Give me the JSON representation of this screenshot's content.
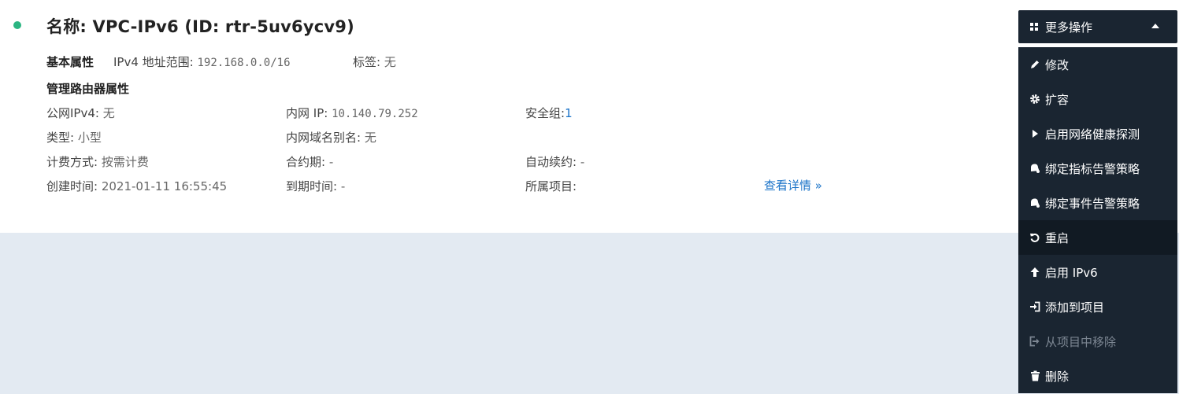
{
  "header": {
    "title": "名称: VPC-IPv6 (ID: rtr-5uv6ycv9)",
    "status_color": "#2bb582"
  },
  "basic": {
    "section_label": "基本属性",
    "ipv4_range_label": "IPv4 地址范围:",
    "ipv4_range_value": "192.168.0.0/16",
    "tags_label": "标签:",
    "tags_value": "无"
  },
  "mgmt": {
    "section_label": "管理路由器属性",
    "public_ipv4_label": "公网IPv4:",
    "public_ipv4_value": "无",
    "private_ip_label": "内网 IP:",
    "private_ip_value": "10.140.79.252",
    "security_group_label": "安全组:",
    "security_group_value": "1",
    "type_label": "类型:",
    "type_value": "小型",
    "private_domain_label": "内网域名别名:",
    "private_domain_value": "无",
    "billing_label": "计费方式:",
    "billing_value": "按需计费",
    "contract_label": "合约期:",
    "contract_value": "-",
    "auto_renew_label": "自动续约:",
    "auto_renew_value": "-",
    "created_label": "创建时间:",
    "created_value": "2021-01-11 16:55:45",
    "expire_label": "到期时间:",
    "expire_value": "-",
    "project_label": "所属项目:",
    "project_value": "",
    "details_link": "查看详情 »"
  },
  "actions": {
    "button_label": "更多操作",
    "items": [
      {
        "label": "修改",
        "icon": "pencil-icon"
      },
      {
        "label": "扩容",
        "icon": "gear-icon"
      },
      {
        "label": "启用网络健康探测",
        "icon": "play-icon"
      },
      {
        "label": "绑定指标告警策略",
        "icon": "bell-icon"
      },
      {
        "label": "绑定事件告警策略",
        "icon": "bell-icon"
      },
      {
        "label": "重启",
        "icon": "restart-icon"
      },
      {
        "label": "启用 IPv6",
        "icon": "arrow-up-icon"
      },
      {
        "label": "添加到项目",
        "icon": "sign-in-icon"
      },
      {
        "label": "从项目中移除",
        "icon": "sign-out-icon",
        "disabled": true
      },
      {
        "label": "删除",
        "icon": "trash-icon"
      }
    ],
    "colors": {
      "menu_bg": "#1a2531",
      "hover_bg": "#111a23",
      "disabled_text": "#7d8793"
    }
  }
}
